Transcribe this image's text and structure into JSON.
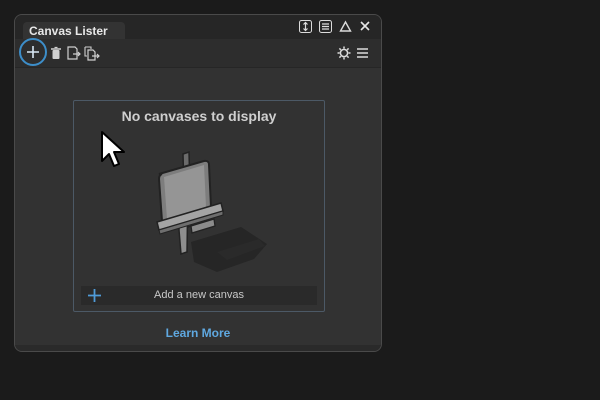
{
  "panel": {
    "tab_title": "Canvas Lister"
  },
  "title_controls": [
    {
      "icon": "resize-vertical-icon"
    },
    {
      "icon": "list-icon"
    },
    {
      "icon": "triangle-up-icon"
    },
    {
      "icon": "close-icon"
    }
  ],
  "toolbar": {
    "left_icons": [
      "plus-icon",
      "trash-icon",
      "export-icon",
      "export-multiple-icon"
    ],
    "right_icons": [
      "gear-icon",
      "hamburger-menu-icon"
    ]
  },
  "empty_state": {
    "title": "No canvases to display",
    "illustration": "easel-icon",
    "add_label": "Add a new canvas",
    "add_icon": "plus-icon"
  },
  "footer": {
    "learn_more": "Learn More"
  },
  "colors": {
    "accent": "#3d8ec9",
    "link": "#5fa8e0",
    "panel_bg": "#323232",
    "page_bg": "#1b1b1b"
  }
}
